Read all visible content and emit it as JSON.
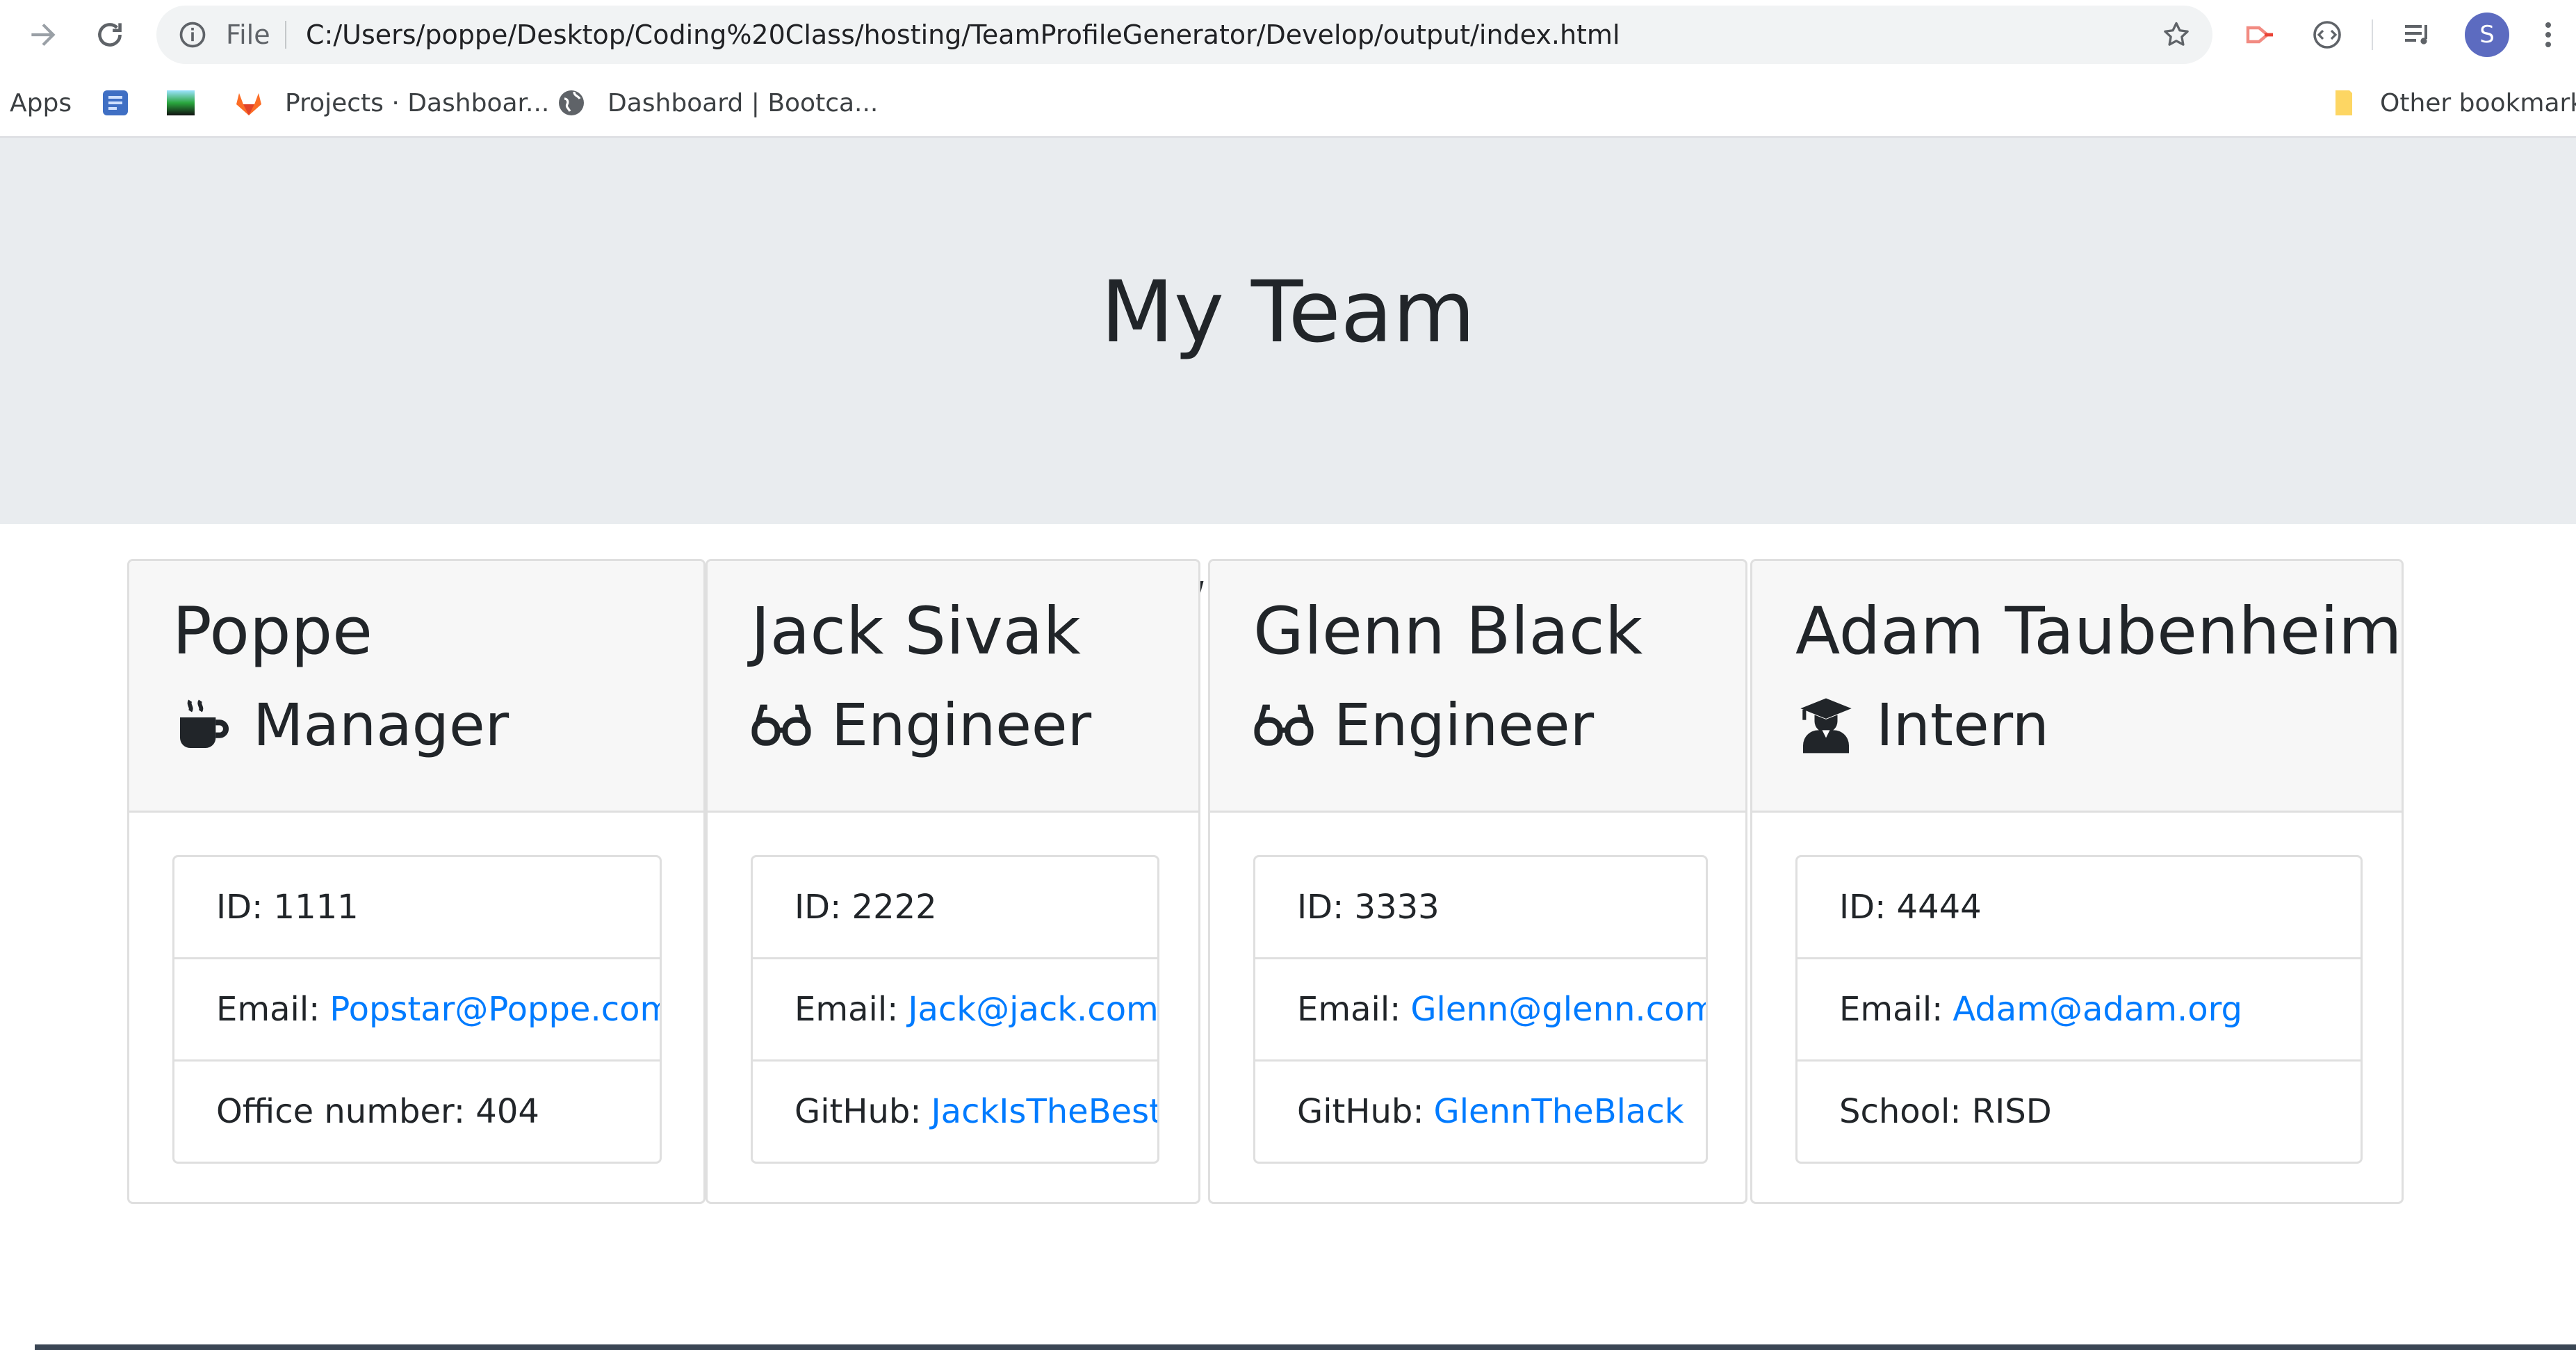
{
  "browser": {
    "scheme_label": "File",
    "url": "C:/Users/poppe/Desktop/Coding%20Class/hosting/TeamProfileGenerator/Develop/output/index.html",
    "bookmarks": [
      {
        "label": "Apps",
        "icon": "apps-icon"
      },
      {
        "label": "",
        "icon": "blue-bookmark-icon"
      },
      {
        "label": "",
        "icon": "gradient-bookmark-icon"
      },
      {
        "label": "Projects · Dashboar...",
        "icon": "gitlab-icon"
      },
      {
        "label": "Dashboard | Bootca...",
        "icon": "globe-icon"
      }
    ],
    "other_bookmarks": "Other bookmarks",
    "avatar_letter": "S"
  },
  "page": {
    "title": "My Team"
  },
  "team": [
    {
      "name": "Poppe",
      "role": "Manager",
      "role_icon": "mug-icon",
      "id": "ID: 1111",
      "email_label": "Email:",
      "email": "Popstar@Poppe.com",
      "extra_label": "Office number: 404",
      "extra_link": ""
    },
    {
      "name": "Jack Sivak",
      "role": "Engineer",
      "role_icon": "glasses-icon",
      "id": "ID: 2222",
      "email_label": "Email:",
      "email": "Jack@jack.com",
      "extra_label": "GitHub:",
      "extra_link": "JackIsTheBest"
    },
    {
      "name": "Glenn Black",
      "role": "Engineer",
      "role_icon": "glasses-icon",
      "id": "ID: 3333",
      "email_label": "Email:",
      "email": "Glenn@glenn.com",
      "extra_label": "GitHub:",
      "extra_link": "GlennTheBlack"
    },
    {
      "name": "Adam Taubenheim",
      "role": "Intern",
      "role_icon": "graduate-icon",
      "id": "ID: 4444",
      "email_label": "Email:",
      "email": "Adam@adam.org",
      "extra_label": "School: RISD",
      "extra_link": ""
    }
  ],
  "colors": {
    "link": "#007bff",
    "jumbotron": "#e9ecef",
    "card_header": "#f7f7f7"
  }
}
